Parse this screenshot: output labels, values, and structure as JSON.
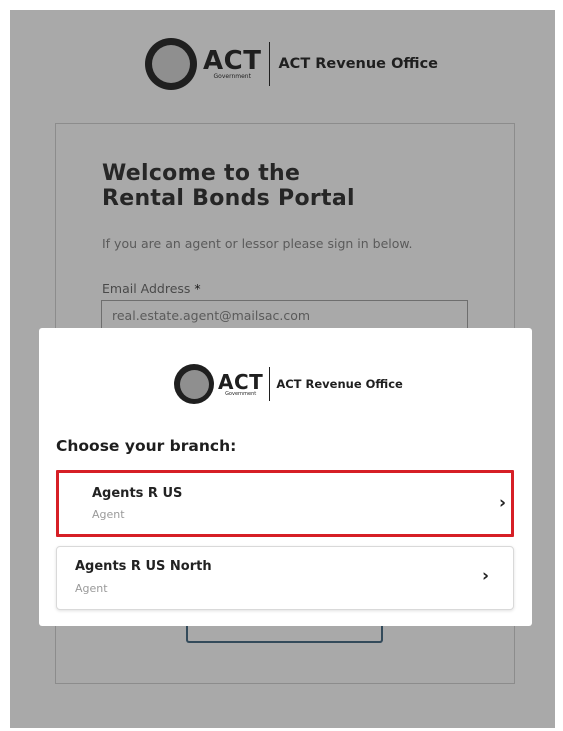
{
  "header": {
    "brand_act": "ACT",
    "brand_government": "Government",
    "brand_office": "ACT Revenue Office"
  },
  "login": {
    "title_line1": "Welcome to the",
    "title_line2": "Rental Bonds Portal",
    "intro": "If you are an agent or lessor please sign in below.",
    "email_label": "Email Address",
    "required_mark": "*",
    "email_value": "real.estate.agent@mailsac.com"
  },
  "modal": {
    "brand_act": "ACT",
    "brand_government": "Government",
    "brand_office": "ACT Revenue Office",
    "title": "Choose your branch:",
    "branches": [
      {
        "name": "Agents R US",
        "role": "Agent",
        "chevron": "›"
      },
      {
        "name": "Agents R US North",
        "role": "Agent",
        "chevron": "›"
      }
    ]
  },
  "colors": {
    "overlay": "#a9a9a9",
    "selected_border": "#d61f26",
    "primary_button_border": "#334a5a"
  }
}
